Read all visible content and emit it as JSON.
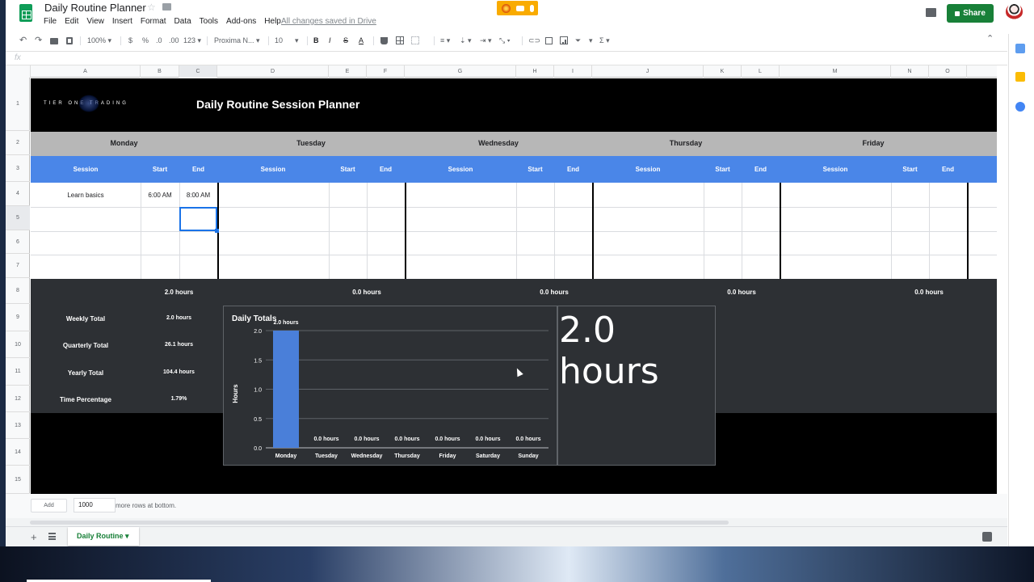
{
  "app": {
    "doc_title": "Daily Routine Planner",
    "menus": [
      "File",
      "Edit",
      "View",
      "Insert",
      "Format",
      "Data",
      "Tools",
      "Add-ons",
      "Help"
    ],
    "save_status": "All changes saved in Drive",
    "share_label": "Share"
  },
  "toolbar": {
    "zoom": "100%",
    "currency": "$",
    "percent": "%",
    "dec_decrease": ".0",
    "dec_increase": ".00",
    "more_formats": "123",
    "font": "Proxima N...",
    "font_size": "10",
    "bold": "B",
    "italic": "I",
    "strike": "S",
    "text_color": "A",
    "functions": "Σ"
  },
  "formula_bar": {
    "fx": "fx"
  },
  "columns": [
    "A",
    "B",
    "C",
    "D",
    "E",
    "F",
    "G",
    "H",
    "I",
    "J",
    "K",
    "L",
    "M",
    "N",
    "O"
  ],
  "rows": [
    "1",
    "2",
    "3",
    "4",
    "5",
    "6",
    "7",
    "8",
    "9",
    "10",
    "11",
    "12",
    "13",
    "14",
    "15"
  ],
  "header": {
    "logo_text": "TIER ONE TRADING",
    "title": "Daily Routine Session Planner"
  },
  "days": [
    "Monday",
    "Tuesday",
    "Wednesday",
    "Thursday",
    "Friday"
  ],
  "subheaders": {
    "session": "Session",
    "start": "Start",
    "end": "End"
  },
  "monday_entry": {
    "session": "Learn basics",
    "start": "6:00 AM",
    "end": "8:00 AM"
  },
  "day_totals": [
    "2.0 hours",
    "0.0 hours",
    "0.0 hours",
    "0.0 hours",
    "0.0 hours"
  ],
  "summary": [
    {
      "label": "Weekly Total",
      "value": "2.0 hours"
    },
    {
      "label": "Quarterly Total",
      "value": "26.1 hours"
    },
    {
      "label": "Yearly Total",
      "value": "104.4 hours"
    },
    {
      "label": "Time Percentage",
      "value": "1.79%"
    }
  ],
  "scorecard": {
    "value": "2.0 hours"
  },
  "chart_data": {
    "type": "bar",
    "title": "Daily Totals",
    "ylabel": "Hours",
    "xlabel": "",
    "categories": [
      "Monday",
      "Tuesday",
      "Wednesday",
      "Thursday",
      "Friday",
      "Saturday",
      "Sunday"
    ],
    "values": [
      2.0,
      0.0,
      0.0,
      0.0,
      0.0,
      0.0,
      0.0
    ],
    "data_labels": [
      "2.0 hours",
      "0.0 hours",
      "0.0 hours",
      "0.0 hours",
      "0.0 hours",
      "0.0 hours",
      "0.0 hours"
    ],
    "ylim": [
      0,
      2.0
    ],
    "yticks": [
      "0.0",
      "0.5",
      "1.0",
      "1.5",
      "2.0"
    ],
    "grid": true,
    "bar_color": "#4a7fd9",
    "background": "#2d3034"
  },
  "bottom": {
    "add_label": "Add",
    "rows_value": "1000",
    "rows_label": "more rows at bottom."
  },
  "sheet_tab": {
    "label": "Daily Routine"
  },
  "colors": {
    "black_band": "#000000",
    "day_header_bg": "#b7b7b7",
    "subheader_bg": "#4a86e8",
    "dark_band": "#2d3034",
    "share_green": "#188038"
  }
}
